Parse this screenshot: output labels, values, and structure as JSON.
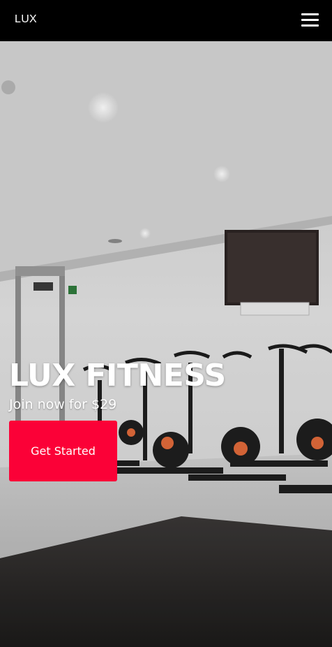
{
  "nav": {
    "logo": "LUX",
    "menu_icon": "hamburger-menu-icon"
  },
  "hero": {
    "title": "LUX FITNESS",
    "subtitle": "Join now for $29",
    "cta_label": "Get Started",
    "background_description_icon": "gym-spin-bikes-photo"
  },
  "colors": {
    "nav_bg": "#000000",
    "cta_bg": "#fb0137",
    "text": "#ffffff"
  }
}
